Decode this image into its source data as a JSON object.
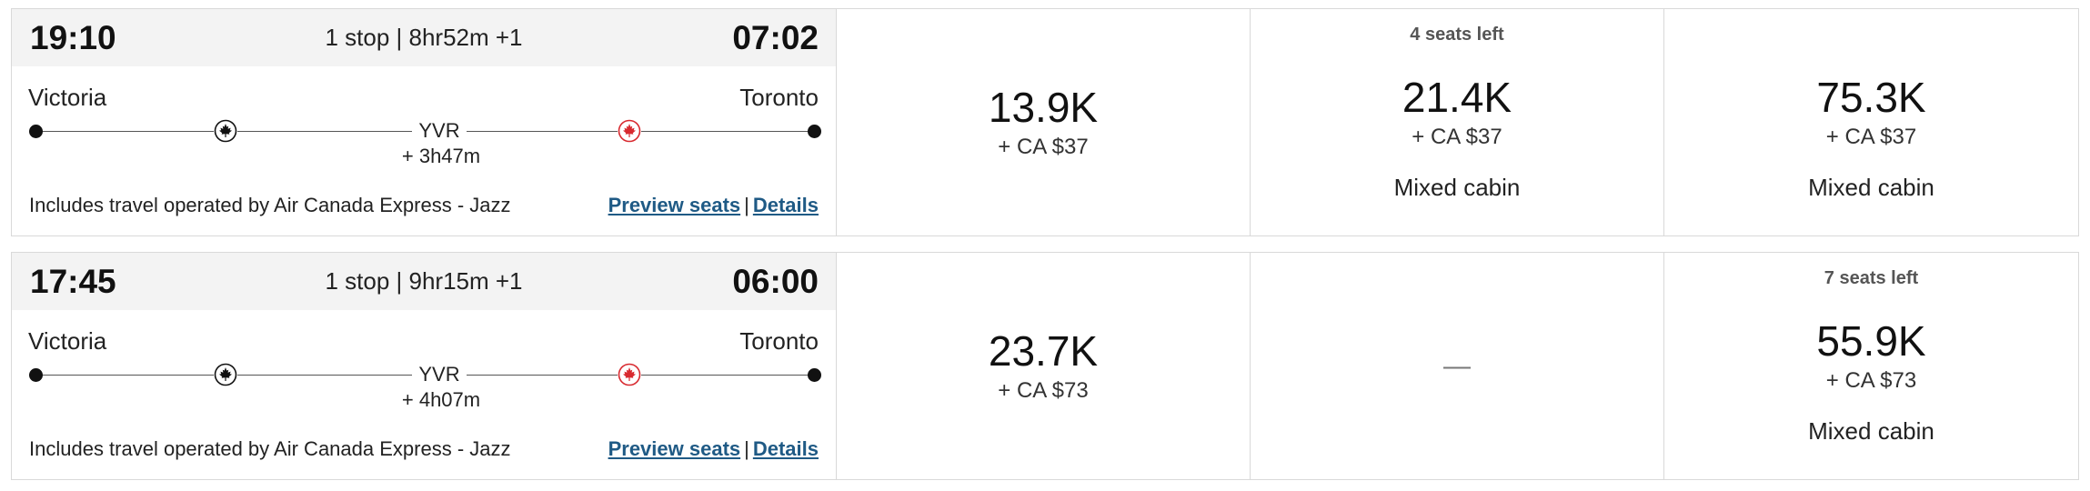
{
  "flights": [
    {
      "departure_time": "19:10",
      "arrival_time": "07:02",
      "summary": "1 stop | 8hr52m +1",
      "origin": "Victoria",
      "destination": "Toronto",
      "stop_code": "YVR",
      "layover": "+ 3h47m",
      "operator_note": "Includes travel operated by Air Canada Express - Jazz",
      "preview_seats_label": "Preview seats",
      "separator": "|",
      "details_label": "Details",
      "fares": [
        {
          "points": "13.9K",
          "taxes": "+ CA $37"
        },
        {
          "seats_left": "4 seats left",
          "points": "21.4K",
          "taxes": "+ CA $37",
          "note": "Mixed cabin"
        },
        {
          "points": "75.3K",
          "taxes": "+ CA $37",
          "note": "Mixed cabin"
        }
      ]
    },
    {
      "departure_time": "17:45",
      "arrival_time": "06:00",
      "summary": "1 stop | 9hr15m +1",
      "origin": "Victoria",
      "destination": "Toronto",
      "stop_code": "YVR",
      "layover": "+ 4h07m",
      "operator_note": "Includes travel operated by Air Canada Express - Jazz",
      "preview_seats_label": "Preview seats",
      "separator": "|",
      "details_label": "Details",
      "fares": [
        {
          "points": "23.7K",
          "taxes": "+ CA $73"
        },
        {
          "unavailable": "—"
        },
        {
          "seats_left": "7 seats left",
          "points": "55.9K",
          "taxes": "+ CA $73",
          "note": "Mixed cabin"
        }
      ]
    }
  ],
  "icons": {
    "carrier_icon_1": "air-canada-maple-leaf-black",
    "carrier_icon_2": "air-canada-maple-leaf-red"
  },
  "colors": {
    "link": "#1f5a85",
    "brand_red": "#d8292f",
    "header_bg": "#f3f3f3"
  }
}
